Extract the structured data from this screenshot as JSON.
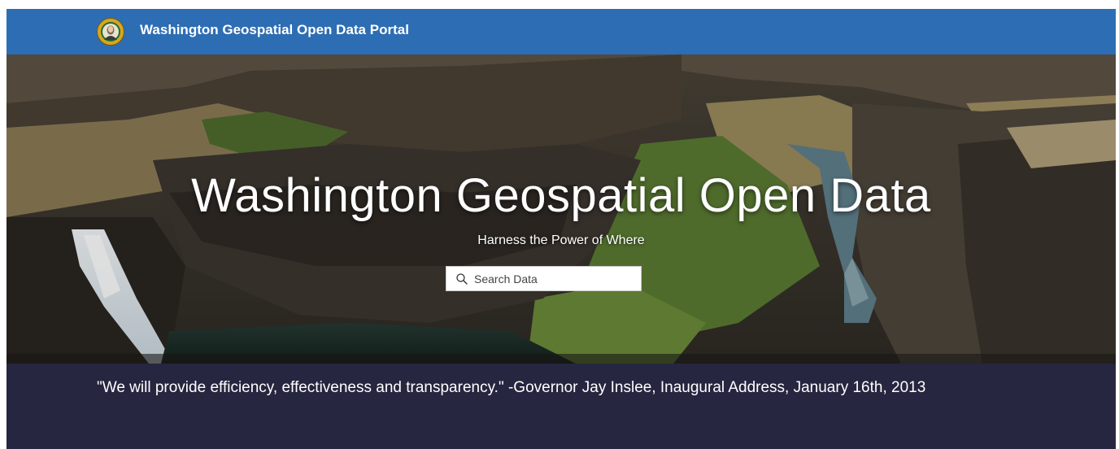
{
  "header": {
    "site_title": "Washington Geospatial Open Data Portal",
    "seal_icon": "state-seal-icon",
    "background_color": "#2d6db3"
  },
  "hero": {
    "title": "Washington Geospatial Open Data",
    "subtitle": "Harness the Power of Where",
    "search": {
      "placeholder": "Search Data",
      "icon": "search-icon"
    }
  },
  "quote": {
    "text": "\"We will provide efficiency, effectiveness and transparency.\" -Governor Jay Inslee, Inaugural Address, January 16th, 2013",
    "background_color": "#262640"
  }
}
